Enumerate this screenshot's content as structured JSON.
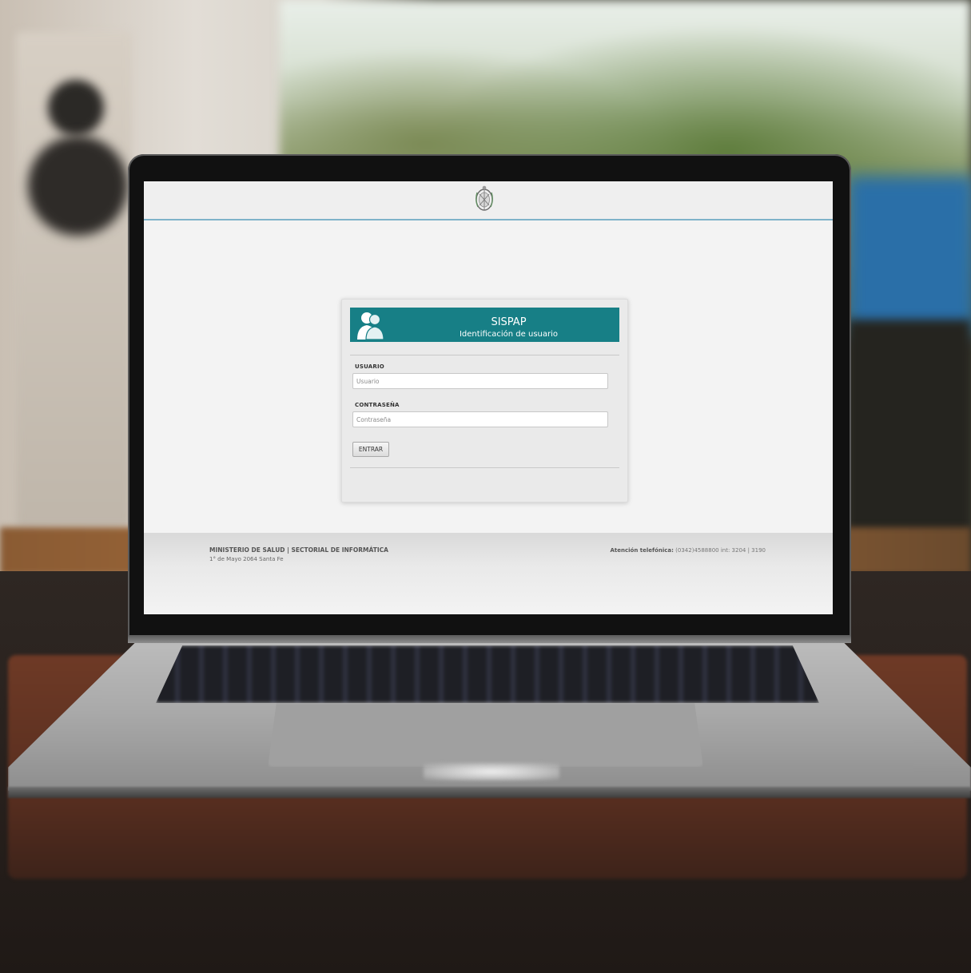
{
  "header": {
    "emblem_icon": "provincial-seal-icon"
  },
  "login": {
    "app_title": "SISPAP",
    "subtitle": "Identificación de usuario",
    "header_color": "#177f86",
    "user_icon": "users-icon",
    "username": {
      "label": "USUARIO",
      "placeholder": "Usuario",
      "value": ""
    },
    "password": {
      "label": "CONTRASEÑA",
      "placeholder": "Contraseña",
      "value": ""
    },
    "submit_label": "ENTRAR"
  },
  "footer": {
    "org": "MINISTERIO DE SALUD | SECTORIAL DE INFORMÁTICA",
    "address": "1° de Mayo 2064 Santa Fe",
    "phone_label": "Atención telefónica:",
    "phone_value": " (0342)4588800 int: 3204 | 3190"
  }
}
